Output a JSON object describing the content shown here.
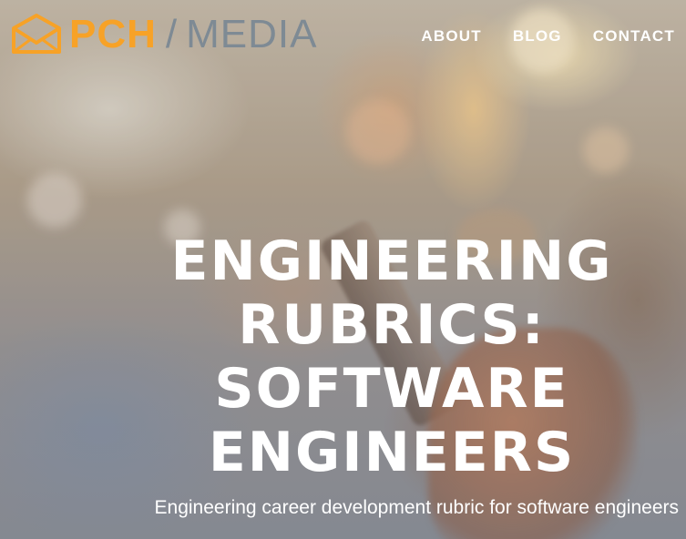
{
  "brand": {
    "logo_primary": "PCH",
    "logo_separator": "/",
    "logo_secondary": "MEDIA",
    "icon": "envelope-icon",
    "primary_color": "#f7a227",
    "secondary_color": "#7e8a94"
  },
  "nav": {
    "items": [
      {
        "label": "ABOUT"
      },
      {
        "label": "BLOG"
      },
      {
        "label": "CONTACT"
      }
    ]
  },
  "hero": {
    "title_lines": [
      "ENGINEERING",
      "RUBRICS:",
      "SOFTWARE",
      "ENGINEERS"
    ],
    "subtitle": "Engineering career development rubric for software engineers"
  }
}
